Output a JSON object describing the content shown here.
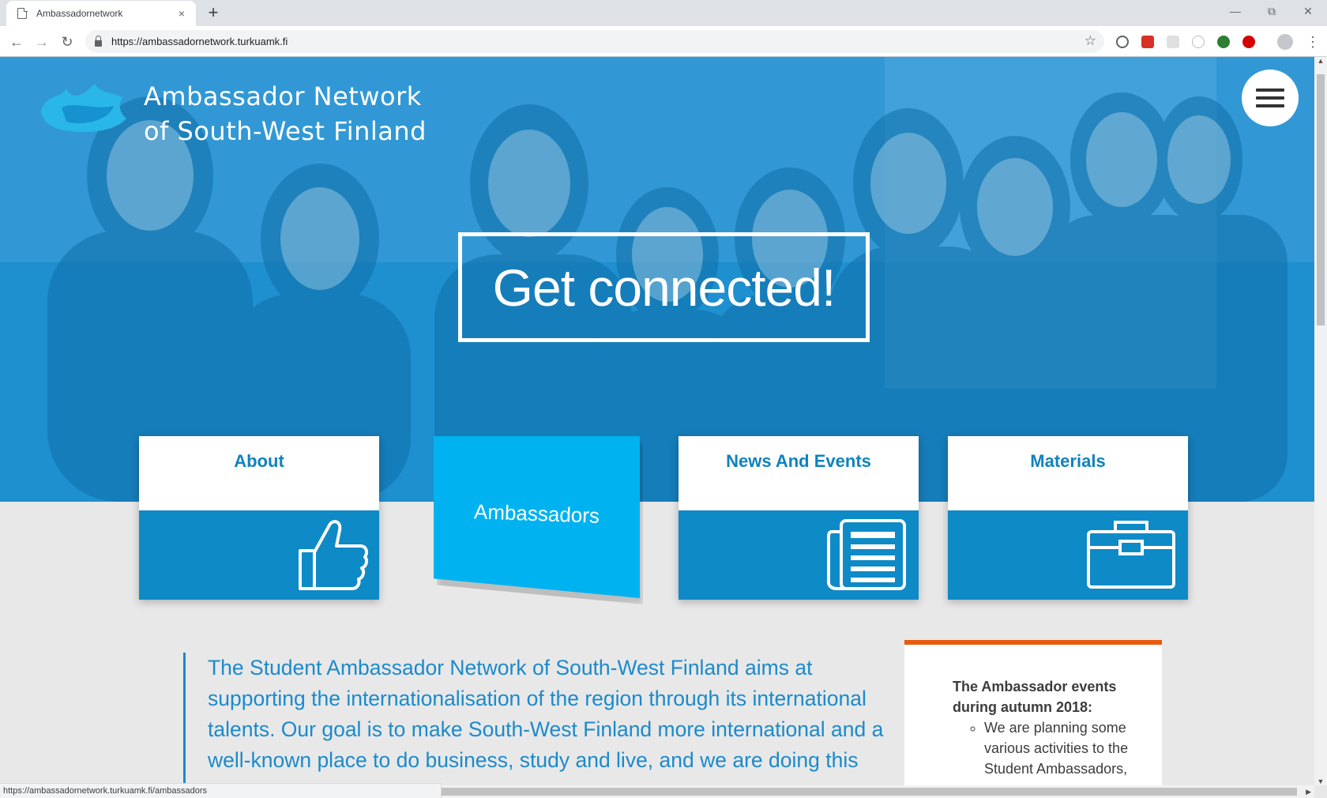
{
  "browser": {
    "tab_title": "Ambassadornetwork",
    "tab_close": "×",
    "new_tab": "+",
    "url": "https://ambassadornetwork.turkuamk.fi",
    "status_url": "https://ambassadornetwork.turkuamk.fi/ambassadors"
  },
  "site": {
    "logo_line1": "Ambassador Network",
    "logo_line2": "of South-West Finland",
    "headline": "Get connected!"
  },
  "cards": {
    "about": "About",
    "ambassadors": "Ambassadors",
    "news": "News And Events",
    "materials": "Materials"
  },
  "intro": "The Student Ambassador Network of South-West Finland aims at supporting the internationalisation of the region through its international talents. Our goal is to make South-West Finland more international and a well-known place to do business, study and live, and we are doing this",
  "events": {
    "title": "The Ambassador events during autumn 2018:",
    "items": [
      "We are planning some various activities to the Student Ambassadors,"
    ]
  },
  "colors": {
    "hero_blue": "#1e8fcf",
    "card_blue": "#0e8ac6",
    "highlight_blue": "#00b3f0",
    "accent_orange": "#e85a0c"
  },
  "icons": [
    "page-icon",
    "back-icon",
    "forward-icon",
    "reload-icon",
    "lock-icon",
    "star-icon",
    "menu-icon",
    "thumbs-up-icon",
    "newspaper-icon",
    "briefcase-icon",
    "hamburger-icon"
  ]
}
